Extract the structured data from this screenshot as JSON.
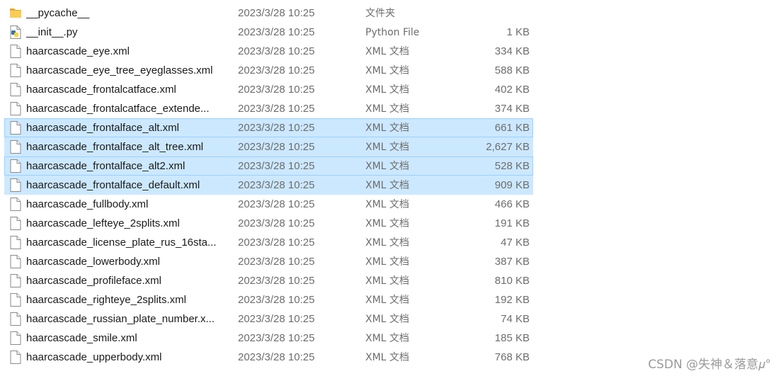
{
  "colors": {
    "selection_bg": "#cce8ff",
    "selection_border": "#99d1ff",
    "folder_yellow": "#f8cd54",
    "python_blue": "#3a73a6",
    "python_yellow": "#ffd43b"
  },
  "files": [
    {
      "name": "__pycache__",
      "date": "2023/3/28 10:25",
      "type": "文件夹",
      "size": "",
      "icon": "folder-icon",
      "selected": false
    },
    {
      "name": "__init__.py",
      "date": "2023/3/28 10:25",
      "type": "Python File",
      "size": "1 KB",
      "icon": "python-file-icon",
      "selected": false
    },
    {
      "name": "haarcascade_eye.xml",
      "date": "2023/3/28 10:25",
      "type": "XML 文档",
      "size": "334 KB",
      "icon": "xml-file-icon",
      "selected": false
    },
    {
      "name": "haarcascade_eye_tree_eyeglasses.xml",
      "date": "2023/3/28 10:25",
      "type": "XML 文档",
      "size": "588 KB",
      "icon": "xml-file-icon",
      "selected": false
    },
    {
      "name": "haarcascade_frontalcatface.xml",
      "date": "2023/3/28 10:25",
      "type": "XML 文档",
      "size": "402 KB",
      "icon": "xml-file-icon",
      "selected": false
    },
    {
      "name": "haarcascade_frontalcatface_extende...",
      "date": "2023/3/28 10:25",
      "type": "XML 文档",
      "size": "374 KB",
      "icon": "xml-file-icon",
      "selected": false
    },
    {
      "name": "haarcascade_frontalface_alt.xml",
      "date": "2023/3/28 10:25",
      "type": "XML 文档",
      "size": "661 KB",
      "icon": "xml-file-icon",
      "selected": true,
      "focused": true
    },
    {
      "name": "haarcascade_frontalface_alt_tree.xml",
      "date": "2023/3/28 10:25",
      "type": "XML 文档",
      "size": "2,627 KB",
      "icon": "xml-file-icon",
      "selected": true,
      "focused": false
    },
    {
      "name": "haarcascade_frontalface_alt2.xml",
      "date": "2023/3/28 10:25",
      "type": "XML 文档",
      "size": "528 KB",
      "icon": "xml-file-icon",
      "selected": true,
      "focused": true
    },
    {
      "name": "haarcascade_frontalface_default.xml",
      "date": "2023/3/28 10:25",
      "type": "XML 文档",
      "size": "909 KB",
      "icon": "xml-file-icon",
      "selected": true,
      "focused": false
    },
    {
      "name": "haarcascade_fullbody.xml",
      "date": "2023/3/28 10:25",
      "type": "XML 文档",
      "size": "466 KB",
      "icon": "xml-file-icon",
      "selected": false
    },
    {
      "name": "haarcascade_lefteye_2splits.xml",
      "date": "2023/3/28 10:25",
      "type": "XML 文档",
      "size": "191 KB",
      "icon": "xml-file-icon",
      "selected": false
    },
    {
      "name": "haarcascade_license_plate_rus_16sta...",
      "date": "2023/3/28 10:25",
      "type": "XML 文档",
      "size": "47 KB",
      "icon": "xml-file-icon",
      "selected": false
    },
    {
      "name": "haarcascade_lowerbody.xml",
      "date": "2023/3/28 10:25",
      "type": "XML 文档",
      "size": "387 KB",
      "icon": "xml-file-icon",
      "selected": false
    },
    {
      "name": "haarcascade_profileface.xml",
      "date": "2023/3/28 10:25",
      "type": "XML 文档",
      "size": "810 KB",
      "icon": "xml-file-icon",
      "selected": false
    },
    {
      "name": "haarcascade_righteye_2splits.xml",
      "date": "2023/3/28 10:25",
      "type": "XML 文档",
      "size": "192 KB",
      "icon": "xml-file-icon",
      "selected": false
    },
    {
      "name": "haarcascade_russian_plate_number.x...",
      "date": "2023/3/28 10:25",
      "type": "XML 文档",
      "size": "74 KB",
      "icon": "xml-file-icon",
      "selected": false
    },
    {
      "name": "haarcascade_smile.xml",
      "date": "2023/3/28 10:25",
      "type": "XML 文档",
      "size": "185 KB",
      "icon": "xml-file-icon",
      "selected": false
    },
    {
      "name": "haarcascade_upperbody.xml",
      "date": "2023/3/28 10:25",
      "type": "XML 文档",
      "size": "768 KB",
      "icon": "xml-file-icon",
      "selected": false
    }
  ],
  "watermark": "CSDN @失神＆落意𝜇°"
}
